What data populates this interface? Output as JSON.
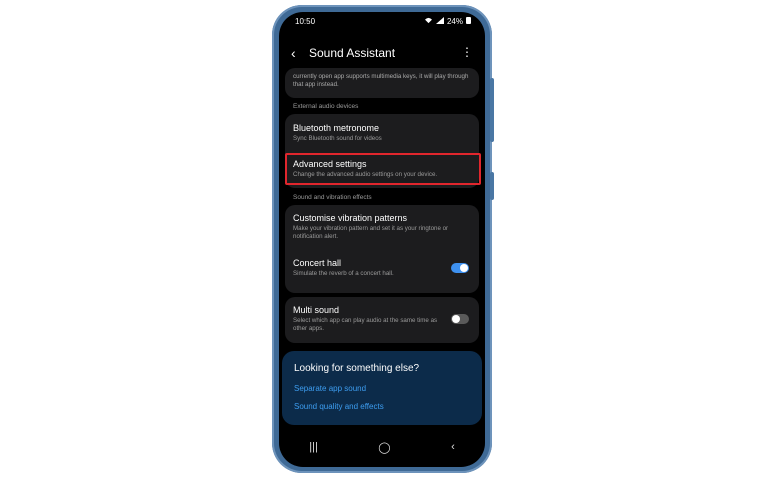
{
  "status": {
    "time": "10:50",
    "battery": "24%",
    "wifi_icon": "wifi-icon",
    "signal_icon": "signal-icon"
  },
  "header": {
    "title": "Sound Assistant"
  },
  "top_card": {
    "text": "currently open app supports multimedia keys, it will play through that app instead."
  },
  "sections": {
    "external": "External audio devices",
    "sound_vibration": "Sound and vibration effects"
  },
  "items": {
    "bt_metronome": {
      "title": "Bluetooth metronome",
      "subtitle": "Sync Bluetooth sound for videos"
    },
    "advanced": {
      "title": "Advanced settings",
      "subtitle": "Change the advanced audio settings on your device."
    },
    "vibration": {
      "title": "Customise vibration patterns",
      "subtitle": "Make your vibration pattern and set it as your ringtone or notification alert."
    },
    "concert": {
      "title": "Concert hall",
      "subtitle": "Simulate the reverb of a concert hall.",
      "enabled": true
    },
    "multi": {
      "title": "Multi sound",
      "subtitle": "Select which app can play audio at the same time as other apps.",
      "enabled": false
    }
  },
  "help": {
    "heading": "Looking for something else?",
    "link1": "Separate app sound",
    "link2": "Sound quality and effects"
  },
  "colors": {
    "accent": "#3d9df0",
    "highlight": "#e1262d",
    "toggle_on": "#3e91f0",
    "toggle_off": "#5a5a5a"
  }
}
